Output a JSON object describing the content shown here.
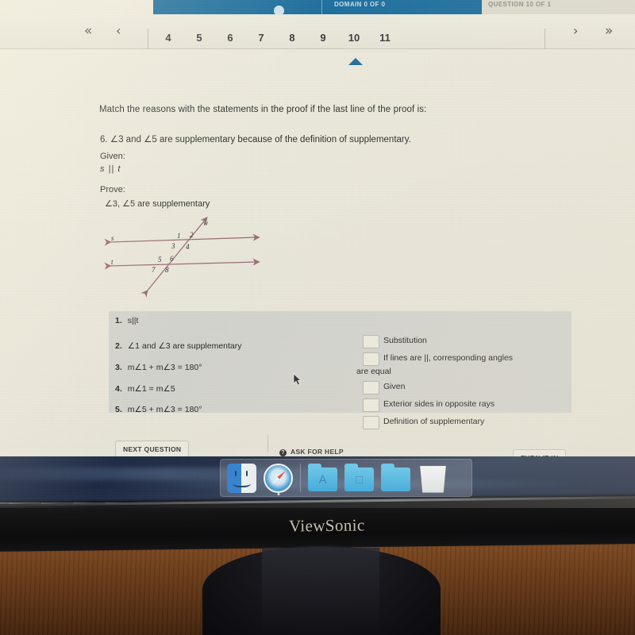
{
  "app_header": {
    "middle_text": "DOMAIN 0 OF 0",
    "right_text": "QUESTION 10 OF 1"
  },
  "pager": {
    "first_label": "«",
    "prev_label": "‹",
    "next_label": "›",
    "last_label": "»",
    "pages": [
      "4",
      "5",
      "6",
      "7",
      "8",
      "9",
      "10",
      "11"
    ],
    "current_page": "10"
  },
  "question": {
    "prompt": "Match the reasons with the statements in the proof if the last line of the proof is:",
    "last_line": "6. ∠3 and ∠5 are supplementary because of the definition of supplementary.",
    "given_label": "Given:",
    "given_value": "s || t",
    "prove_label": "Prove:",
    "prove_value": "∠3, ∠5 are supplementary"
  },
  "figure": {
    "line_s_label": "s",
    "line_t_label": "t",
    "transversal_label": "w",
    "angle_labels": [
      "1",
      "2",
      "3",
      "4",
      "5",
      "6",
      "7",
      "8"
    ],
    "line_color": "#9b6b74"
  },
  "statements": [
    {
      "num": "1.",
      "text": "s||t"
    },
    {
      "num": "2.",
      "text": "∠1 and ∠3 are supplementary"
    },
    {
      "num": "3.",
      "text": "m∠1 + m∠3 = 180°"
    },
    {
      "num": "4.",
      "text": "m∠1 = m∠5"
    },
    {
      "num": "5.",
      "text": "m∠5 + m∠3 = 180°"
    }
  ],
  "options": [
    {
      "label": "Substitution",
      "checked": false
    },
    {
      "label": "If lines are ||, corresponding angles",
      "continuation": "are equal",
      "checked": false
    },
    {
      "label": "Given",
      "checked": false
    },
    {
      "label": "Exterior sides in opposite rays",
      "checked": false
    },
    {
      "label": "Definition of supplementary",
      "checked": false
    }
  ],
  "actions": {
    "next_question": "NEXT QUESTION",
    "ask_for_help": "ASK FOR HELP",
    "help_icon_glyph": "?",
    "turn_it_in": "TURN IT IN"
  },
  "dock": {
    "items": [
      {
        "name": "Finder",
        "icon": "finder-icon"
      },
      {
        "name": "Safari",
        "icon": "safari-icon"
      },
      {
        "name": "Applications",
        "icon": "applications-folder-icon",
        "glyph": "A"
      },
      {
        "name": "Documents",
        "icon": "documents-folder-icon",
        "glyph": "□"
      },
      {
        "name": "Downloads",
        "icon": "downloads-folder-icon",
        "glyph": ""
      },
      {
        "name": "Trash",
        "icon": "trash-icon"
      }
    ]
  },
  "monitor": {
    "brand": "ViewSonic"
  },
  "colors": {
    "header_blue": "#1e6f9e",
    "screen_bg": "#ece9dd",
    "panel_gray": "#c4c7c7",
    "figure_line": "#9b6b74",
    "desktop_blue": "#22304a"
  }
}
